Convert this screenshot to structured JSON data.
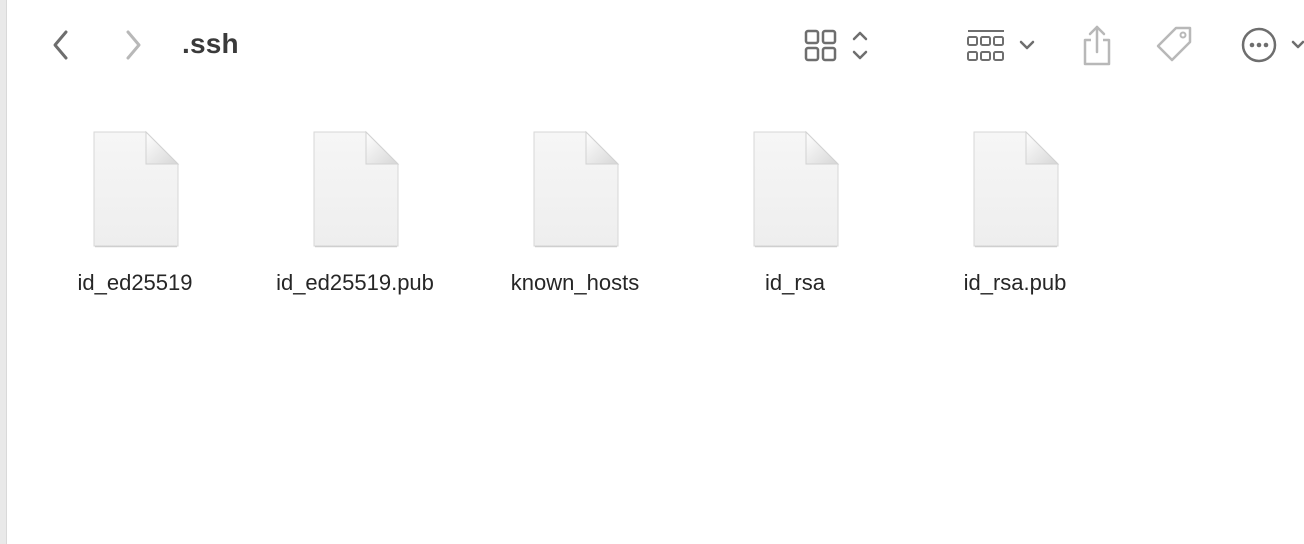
{
  "window": {
    "title": ".ssh"
  },
  "toolbar": {
    "back_icon": "chevron-left-icon",
    "forward_icon": "chevron-right-icon",
    "view_mode_icon": "icon-grid-view-icon",
    "group_icon": "group-by-icon",
    "share_icon": "share-icon",
    "tag_icon": "tag-icon",
    "more_icon": "ellipsis-circle-icon"
  },
  "files": [
    {
      "name": "id_ed25519",
      "icon": "document-icon"
    },
    {
      "name": "id_ed25519.pub",
      "icon": "document-icon"
    },
    {
      "name": "known_hosts",
      "icon": "document-icon"
    },
    {
      "name": "id_rsa",
      "icon": "document-icon"
    },
    {
      "name": "id_rsa.pub",
      "icon": "document-icon"
    }
  ],
  "colors": {
    "icon_active": "#6e6e6e",
    "icon_disabled": "#b8b8b8",
    "text": "#262626"
  }
}
